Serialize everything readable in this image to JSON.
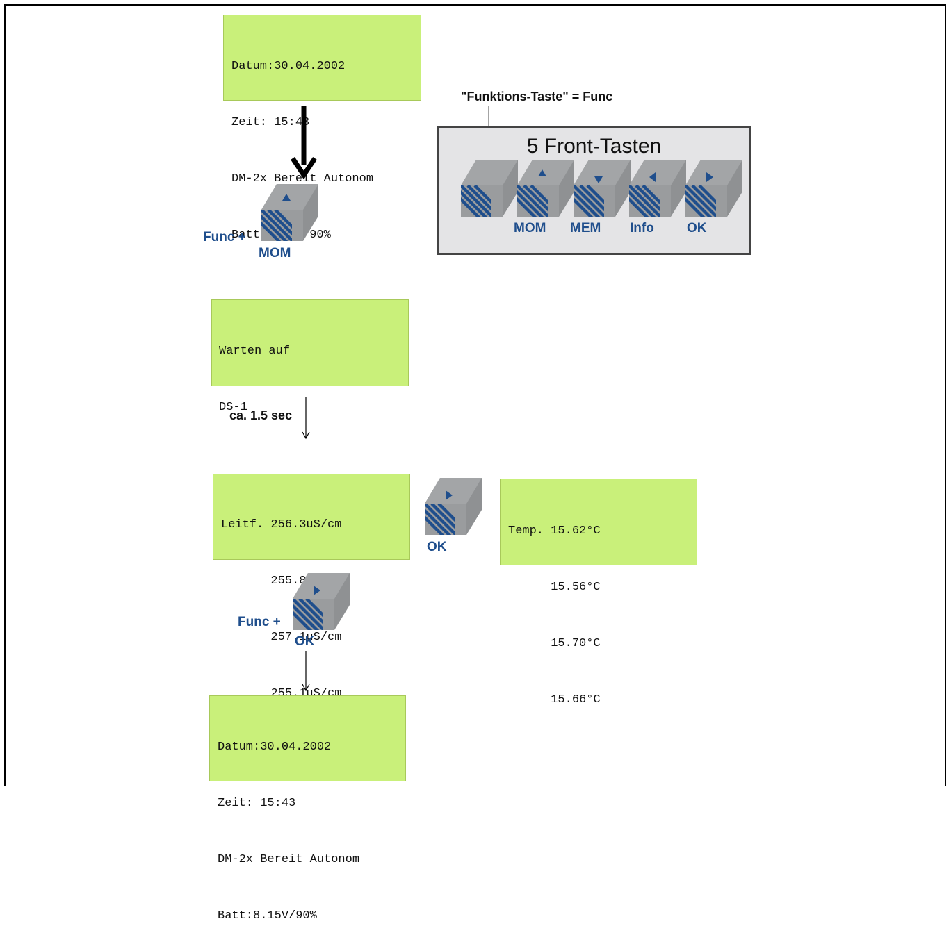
{
  "screens": {
    "start": {
      "lines": [
        "Datum:30.04.2002",
        "Zeit: 15:43",
        "DM-2x Bereit Autonom",
        "Batt:8.15V/90%"
      ]
    },
    "waiting": {
      "lines": [
        "Warten auf",
        "DS-1"
      ]
    },
    "conductivity": {
      "lines": [
        "Leitf. 256.3uS/cm",
        "       255.8uS/cm",
        "       257.1uS/cm",
        "       255.1uS/cm"
      ]
    },
    "temperature": {
      "lines": [
        "Temp. 15.62°C",
        "      15.56°C",
        "      15.70°C",
        "      15.66°C"
      ]
    },
    "end": {
      "lines": [
        "Datum:30.04.2002",
        "Zeit: 15:43",
        "DM-2x Bereit Autonom",
        "Batt:8.15V/90%"
      ]
    }
  },
  "labels": {
    "func_plus_1": "Func +",
    "mom_1": "MOM",
    "delay": "ca. 1.5 sec",
    "ok_side": "OK",
    "func_plus_2": "Func +",
    "ok_2": "OK",
    "func_note": "\"Funktions-Taste\" = Func"
  },
  "panel": {
    "title": "5 Front-Tasten",
    "keys": [
      "MOM",
      "MEM",
      "Info",
      "OK"
    ]
  },
  "colors": {
    "lcd": "#c9f07a",
    "key_face": "#8f9193",
    "stripe": "#1f4e8c"
  }
}
